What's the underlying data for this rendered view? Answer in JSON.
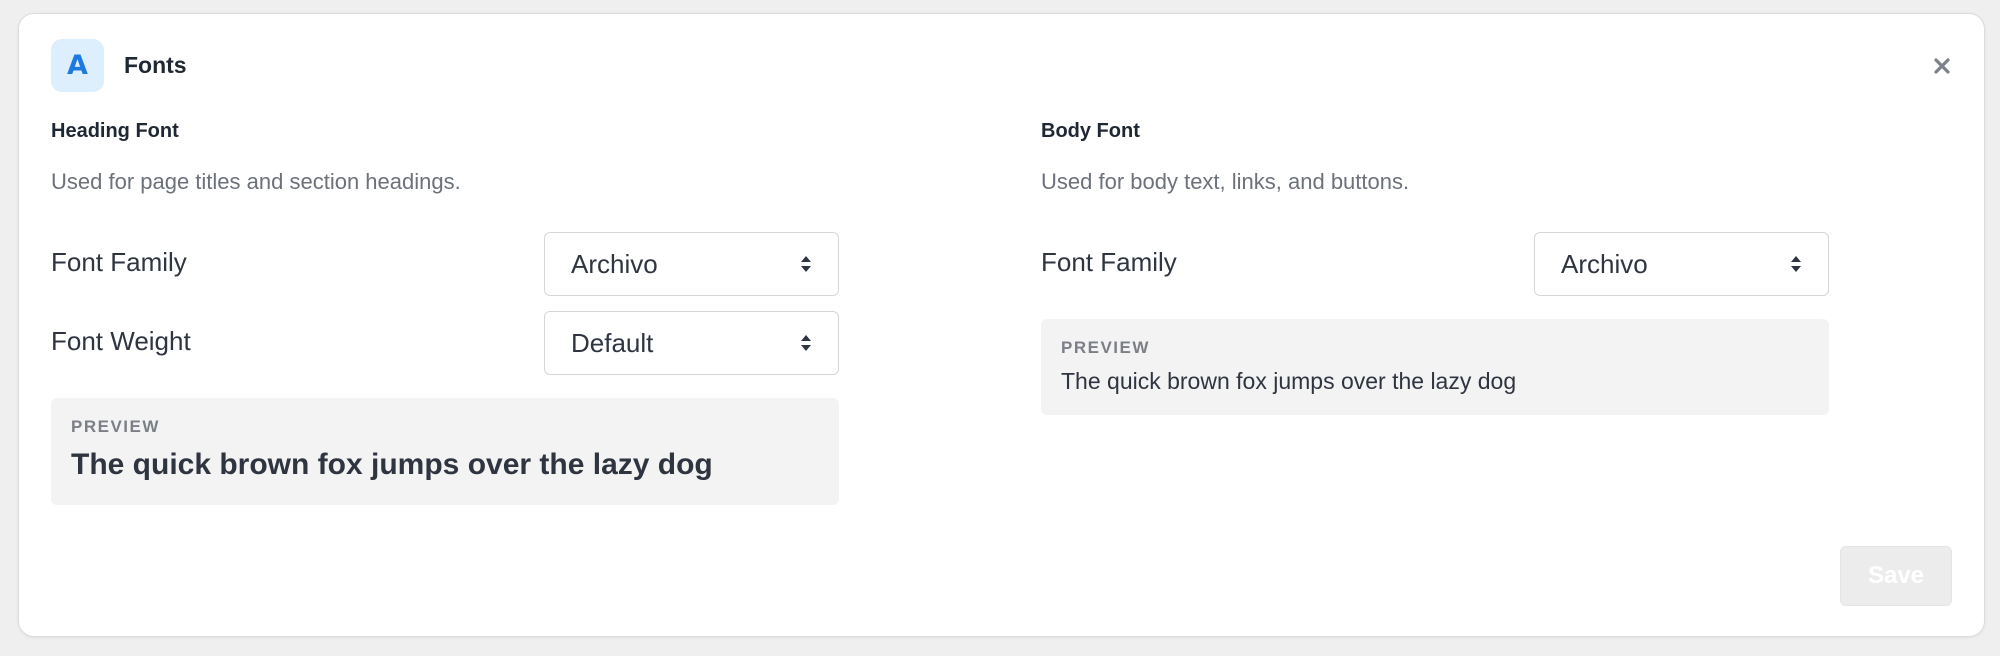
{
  "modal": {
    "title": "Fonts",
    "logo_letter": "A",
    "close_icon": "close-icon",
    "save_label": "Save"
  },
  "heading_font": {
    "title": "Heading Font",
    "description": "Used for page titles and section headings.",
    "family_label": "Font Family",
    "family_value": "Archivo",
    "weight_label": "Font Weight",
    "weight_value": "Default",
    "preview_label": "PREVIEW",
    "preview_text": "The quick brown fox jumps over the lazy dog"
  },
  "body_font": {
    "title": "Body Font",
    "description": "Used for body text, links, and buttons.",
    "family_label": "Font Family",
    "family_value": "Archivo",
    "preview_label": "PREVIEW",
    "preview_text": "The quick brown fox jumps over the lazy dog"
  },
  "colors": {
    "accent": "#1f7ae0",
    "logo_bg": "#ddeefd",
    "preview_bg": "#f3f3f3",
    "save_disabled_bg": "#ececec"
  }
}
